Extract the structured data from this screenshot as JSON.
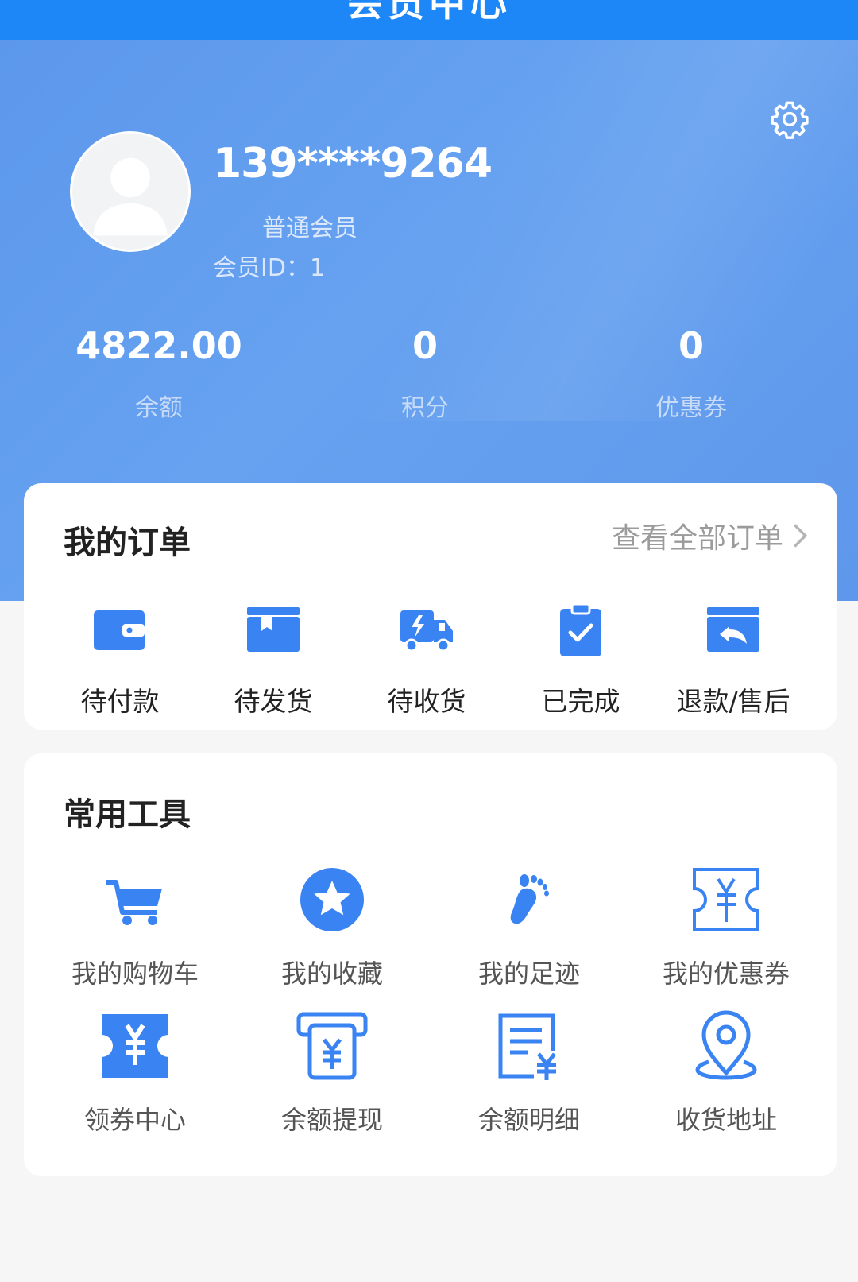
{
  "header": {
    "title": "会员中心"
  },
  "profile": {
    "phone": "139****9264",
    "level": "普通会员",
    "member_id": "会员ID：1"
  },
  "stats": [
    {
      "value": "4822.00",
      "label": "余额"
    },
    {
      "value": "0",
      "label": "积分"
    },
    {
      "value": "0",
      "label": "优惠券"
    }
  ],
  "orders": {
    "title": "我的订单",
    "view_all": "查看全部订单",
    "items": [
      {
        "label": "待付款",
        "icon": "wallet-icon"
      },
      {
        "label": "待发货",
        "icon": "box-icon"
      },
      {
        "label": "待收货",
        "icon": "truck-icon"
      },
      {
        "label": "已完成",
        "icon": "clipboard-check-icon"
      },
      {
        "label": "退款/售后",
        "icon": "refund-icon"
      }
    ]
  },
  "tools": {
    "title": "常用工具",
    "items": [
      {
        "label": "我的购物车",
        "icon": "cart-icon"
      },
      {
        "label": "我的收藏",
        "icon": "star-icon"
      },
      {
        "label": "我的足迹",
        "icon": "footprint-icon"
      },
      {
        "label": "我的优惠券",
        "icon": "coupon-outline-icon"
      },
      {
        "label": "领券中心",
        "icon": "coupon-filled-icon"
      },
      {
        "label": "余额提现",
        "icon": "withdraw-icon"
      },
      {
        "label": "余额明细",
        "icon": "balance-detail-icon"
      },
      {
        "label": "收货地址",
        "icon": "location-icon"
      }
    ]
  },
  "colors": {
    "accent": "#3a83f2",
    "header": "#1d87f7",
    "hero": "#5c97ec"
  }
}
